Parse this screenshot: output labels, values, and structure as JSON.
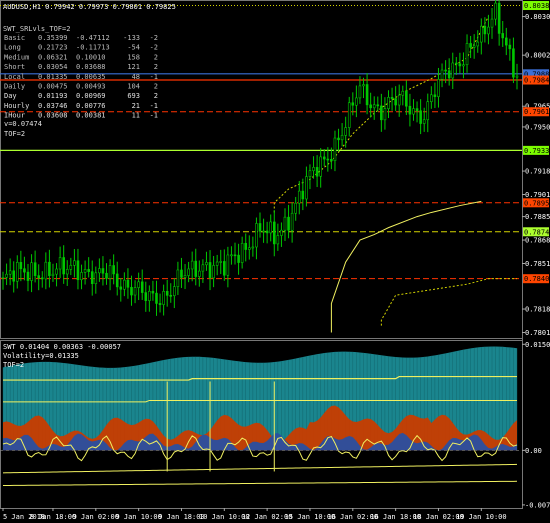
{
  "header": {
    "symbol": "AUDUSD,H1",
    "ohlc": "0.79942 0.79973 0.79801 0.79825"
  },
  "indicator_panel": {
    "title": "SWT_SRLvls_TOF=2",
    "rows": [
      {
        "label": "Basic",
        "v1": "0.35399",
        "v2": "-0.47112",
        "v3": "-133",
        "v4": "-2"
      },
      {
        "label": "Long",
        "v1": "0.21723",
        "v2": "-0.11713",
        "v3": "-54",
        "v4": "-2"
      },
      {
        "label": "Medium",
        "v1": "0.06321",
        "v2": "0.10010",
        "v3": "158",
        "v4": "2"
      },
      {
        "label": "Short",
        "v1": "0.03054",
        "v2": "0.03688",
        "v3": "121",
        "v4": "2"
      },
      {
        "label": "Local",
        "v1": "0.01335",
        "v2": "0.00635",
        "v3": "48",
        "v4": "-1"
      },
      {
        "label": "Daily",
        "v1": "0.00475",
        "v2": "0.00493",
        "v3": "104",
        "v4": "2"
      },
      {
        "label": "Day",
        "v1": "0.01193",
        "v2": "0.00969",
        "v3": "693",
        "v4": "2"
      },
      {
        "label": "Hourly",
        "v1": "0.03746",
        "v2": "0.00776",
        "v3": "21",
        "v4": "-1"
      },
      {
        "label": "IHour",
        "v1": "0.03608",
        "v2": "0.00381",
        "v3": "11",
        "v4": "-1"
      }
    ],
    "footer1": "v=0.07474",
    "footer2": "TOF=2"
  },
  "price_axis": {
    "labels": [
      {
        "v": 0.8038,
        "text": "0.80380",
        "boxed": true,
        "color": "#7cfc00"
      },
      {
        "v": 0.803,
        "text": "0.80300"
      },
      {
        "v": 0.8002,
        "text": "0.80020"
      },
      {
        "v": 0.79885,
        "text": "0.79885",
        "boxed": true,
        "color": "#3b6fd6"
      },
      {
        "v": 0.7984,
        "text": "0.79840",
        "boxed": true,
        "color": "#ff4500"
      },
      {
        "v": 0.7965,
        "text": "0.79650"
      },
      {
        "v": 0.7961,
        "text": "0.79610",
        "boxed": true,
        "color": "#ff4500"
      },
      {
        "v": 0.795,
        "text": "0.79500"
      },
      {
        "v": 0.7933,
        "text": "0.79330",
        "boxed": true,
        "color": "#7cfc00"
      },
      {
        "v": 0.7918,
        "text": "0.79180"
      },
      {
        "v": 0.7901,
        "text": "0.79010"
      },
      {
        "v": 0.7895,
        "text": "0.78950",
        "boxed": true,
        "color": "#ff4500"
      },
      {
        "v": 0.7885,
        "text": "0.78850"
      },
      {
        "v": 0.7874,
        "text": "0.78740",
        "boxed": true,
        "color": "#adff2f"
      },
      {
        "v": 0.7868,
        "text": "0.78680"
      },
      {
        "v": 0.7851,
        "text": "0.78515"
      },
      {
        "v": 0.784,
        "text": "0.78400",
        "boxed": true,
        "color": "#ff4500"
      },
      {
        "v": 0.7818,
        "text": "0.78180"
      },
      {
        "v": 0.7801,
        "text": "0.78015"
      }
    ]
  },
  "levels": [
    {
      "v": 0.8038,
      "color": "#d4d400",
      "style": "dot"
    },
    {
      "v": 0.79885,
      "color": "#3b6fd6",
      "style": "solid"
    },
    {
      "v": 0.7984,
      "color": "#ff3300",
      "style": "solid"
    },
    {
      "v": 0.7961,
      "color": "#ff3300",
      "style": "dash"
    },
    {
      "v": 0.7933,
      "color": "#adff2f",
      "style": "solid"
    },
    {
      "v": 0.7895,
      "color": "#ff3300",
      "style": "dash"
    },
    {
      "v": 0.7874,
      "color": "#d4d400",
      "style": "dash"
    },
    {
      "v": 0.784,
      "color": "#ff3300",
      "style": "dash"
    }
  ],
  "price_range": [
    0.7797,
    0.8042
  ],
  "sub_header": {
    "line1": "SWT 0.01404 0.00363 -0.00057",
    "line2": "Volatility=0.01335",
    "line3": "TOF=2"
  },
  "sub_axis": [
    {
      "v": 0.01509,
      "text": "0.01509"
    },
    {
      "v": 0.0,
      "text": "0.00"
    },
    {
      "v": -0.00776,
      "text": "-0.00776"
    }
  ],
  "sub_range": [
    -0.0082,
    0.0157
  ],
  "time_axis": [
    {
      "i": 0,
      "text": "5 Jan 2018"
    },
    {
      "i": 14,
      "text": "8 Jan 18:00"
    },
    {
      "i": 26,
      "text": "9 Jan 02:00"
    },
    {
      "i": 38,
      "text": "9 Jan 10:00"
    },
    {
      "i": 50,
      "text": "9 Jan 18:00"
    },
    {
      "i": 62,
      "text": "10 Jan 10:00"
    },
    {
      "i": 74,
      "text": "12 Jan 02:00"
    },
    {
      "i": 86,
      "text": "15 Jan 10:00"
    },
    {
      "i": 98,
      "text": "16 Jan 02:00"
    },
    {
      "i": 110,
      "text": "16 Jan 18:00"
    },
    {
      "i": 122,
      "text": "18 Jan 02:00"
    },
    {
      "i": 134,
      "text": "19 Jan 10:00"
    }
  ],
  "colors": {
    "candle": "#00c800",
    "grid": "#3a3a3a",
    "text": "#ffffff",
    "cyan_area": "#1b8c96",
    "red_area": "#c83c00",
    "blue_area": "#2a4fa0",
    "yellow": "#f0f060"
  }
}
